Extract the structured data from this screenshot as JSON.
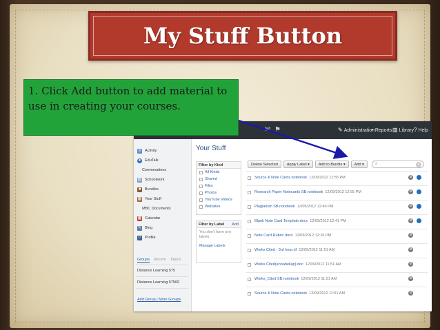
{
  "slide": {
    "title": "My Stuff Button",
    "callout": "1.  Click Add button to add material to use in creating your courses."
  },
  "colors": {
    "title_bg": "#b23a2d",
    "callout_bg": "#22a33a",
    "arrow": "#1a1aa8",
    "topbar": "#2d3238",
    "link": "#2a5ea8"
  },
  "app": {
    "topnav": [
      {
        "icon": "wrench-icon",
        "label": "Administration"
      },
      {
        "icon": "chart-icon",
        "label": "Reports"
      },
      {
        "icon": "books-icon",
        "label": "Library"
      },
      {
        "icon": "help-icon",
        "label": "Help"
      }
    ],
    "sidebar": [
      {
        "label": "Activity",
        "icon": "activity-icon"
      },
      {
        "label": "EduTalk",
        "icon": "edutalk-icon"
      },
      {
        "label": "Conversations",
        "icon": "conversations-icon"
      },
      {
        "label": "Schoolwork",
        "icon": "schoolwork-icon"
      },
      {
        "label": "Bundles",
        "icon": "bundles-icon"
      },
      {
        "label": "Your Stuff",
        "icon": "your-stuff-icon"
      },
      {
        "label": "MBC Documents",
        "icon": "documents-icon"
      },
      {
        "label": "Calendar",
        "icon": "calendar-icon"
      },
      {
        "label": "Blog",
        "icon": "blog-icon"
      },
      {
        "label": "Profile",
        "icon": "profile-icon"
      }
    ],
    "group_tabs": [
      "Groups",
      "Recent",
      "Topics"
    ],
    "groups": [
      "Distance Learning 575",
      "Distance Learning 57500"
    ],
    "group_links": "Add Group | More Groups",
    "heading": "Your Stuff",
    "filter_kind": {
      "title": "Filter by Kind",
      "items": [
        "All Kinds",
        "Shared",
        "Files",
        "Photos",
        "YouTube Videos",
        "Websites"
      ]
    },
    "filter_label": {
      "title": "Filter by Label",
      "add": "Add",
      "note": "You don't have any labels.",
      "manage": "Manage Labels"
    },
    "toolbar": {
      "delete": "Delete Selected",
      "apply_label": "Apply Label ▾",
      "add_to_bundle": "Add to Bundle ▾",
      "add": "Add ▾"
    },
    "search_placeholder": "",
    "items": [
      {
        "name": "Source & Note Cards.notebook",
        "date": "12/09/2012 12:55 PM",
        "globe": true
      },
      {
        "name": "Research Paper Notecards SB.notebook",
        "date": "12/09/2012 12:55 PM",
        "globe": true
      },
      {
        "name": "Plagiarism SB.notebook",
        "date": "12/09/2012 12:46 PM",
        "globe": true
      },
      {
        "name": "Blank Note Card Template.docx",
        "date": "12/09/2012 12:41 PM",
        "globe": true
      },
      {
        "name": "Note Card Rubric.docx",
        "date": "12/09/2012 12:26 PM",
        "globe": false
      },
      {
        "name": "Works Cited - 3rd hour.rtf",
        "date": "12/09/2012 11:51 AM",
        "globe": false
      },
      {
        "name": "Works Cited(annabellap).doc",
        "date": "12/09/2012 11:51 AM",
        "globe": false
      },
      {
        "name": "Works_Cited SB.notebook",
        "date": "12/09/2012 11:51 AM",
        "globe": false
      },
      {
        "name": "Source & Note Cards.notebook",
        "date": "12/09/2012 11:51 AM",
        "globe": false
      }
    ]
  }
}
